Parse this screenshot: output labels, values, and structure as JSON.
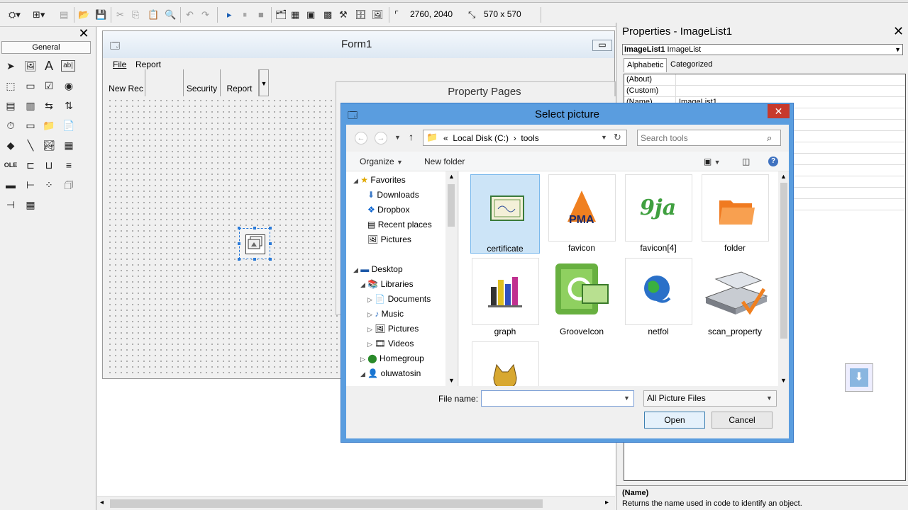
{
  "toolbar": {
    "coords": "2760, 2040",
    "size": "570 x 570"
  },
  "toolbox": {
    "tab": "General",
    "close": "✕"
  },
  "form": {
    "title": "Form1",
    "menus": [
      "File",
      "Report"
    ],
    "toolbar_buttons": [
      "New Rec",
      "",
      "Security",
      "Report"
    ]
  },
  "property_pages": {
    "title": "Property Pages",
    "close": "✕"
  },
  "properties": {
    "title": "Properties - ImageList1",
    "close": "✕",
    "object_name": "ImageList1",
    "object_type": "ImageList",
    "tabs": [
      "Alphabetic",
      "Categorized"
    ],
    "rows": [
      {
        "name": "(About)",
        "value": ""
      },
      {
        "name": "(Custom)",
        "value": ""
      },
      {
        "name": "(Name)",
        "value": "ImageList1"
      }
    ],
    "desc_name": "(Name)",
    "desc_text": "Returns the name used in code to identify an object."
  },
  "dialog": {
    "title": "Select picture",
    "close": "✕",
    "address": {
      "prefix": "«",
      "drive": "Local Disk (C:)",
      "sep": "›",
      "folder": "tools"
    },
    "search_placeholder": "Search tools",
    "organize": "Organize",
    "new_folder": "New folder",
    "nav": {
      "favorites": "Favorites",
      "downloads": "Downloads",
      "dropbox": "Dropbox",
      "recent": "Recent places",
      "pictures": "Pictures",
      "desktop": "Desktop",
      "libraries": "Libraries",
      "documents": "Documents",
      "music": "Music",
      "pictures2": "Pictures",
      "videos": "Videos",
      "homegroup": "Homegroup",
      "user": "oluwatosin"
    },
    "files": [
      {
        "name": "certificate",
        "icon": "certificate-icon",
        "selected": true
      },
      {
        "name": "favicon",
        "icon": "pma-logo-icon",
        "selected": false
      },
      {
        "name": "favicon[4]",
        "icon": "9ja-logo-icon",
        "selected": false
      },
      {
        "name": "folder",
        "icon": "folder-icon",
        "selected": false
      },
      {
        "name": "graph",
        "icon": "bar-graph-icon",
        "selected": false
      },
      {
        "name": "GrooveIcon",
        "icon": "groove-icon",
        "selected": false
      },
      {
        "name": "netfol",
        "icon": "globe-icon",
        "selected": false
      },
      {
        "name": "scan_property",
        "icon": "scanner-icon",
        "selected": false
      },
      {
        "name": "",
        "icon": "cat-icon",
        "selected": false
      }
    ],
    "file_name_label": "File name:",
    "file_name_value": "",
    "filter": "All Picture Files",
    "open_label": "Open",
    "cancel_label": "Cancel"
  },
  "colors": {
    "dialog_frame": "#5a9ddf",
    "close_red": "#c7392c",
    "selection": "#cce4f7"
  }
}
